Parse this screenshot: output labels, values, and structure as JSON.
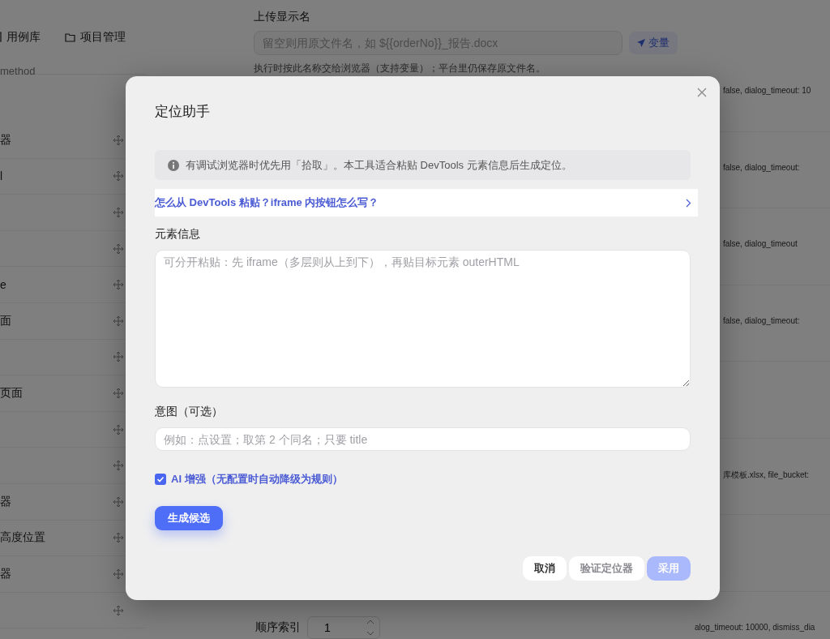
{
  "background": {
    "nav": [
      {
        "kind": "cases",
        "label": "用例库"
      },
      {
        "kind": "projects",
        "label": "项目管理"
      }
    ],
    "list_header": "method",
    "rows": [
      {
        "label": "器"
      },
      {
        "label": "l"
      },
      {},
      {},
      {
        "label": "e"
      },
      {
        "label": "面"
      },
      {},
      {
        "label": "页面"
      },
      {},
      {},
      {
        "label": "器"
      },
      {
        "label": "高度位置"
      },
      {
        "label": "器"
      },
      {}
    ],
    "right_rows": [
      {
        "label": "false, dialog_timeout: 10"
      },
      {
        "label": "false, dialog_timeout:"
      },
      {
        "label": "false, dialog_timeout"
      },
      {
        "label": "false, dialog_timeout:"
      },
      {},
      {
        "label": "库模板.xlsx, file_bucket:"
      },
      {},
      {
        "label": "alog_timeout: 10000, dismiss_dia"
      }
    ],
    "drawer": {
      "name_label": "上传显示名",
      "name_placeholder": "留空则用原文件名，如 ${{orderNo}}_报告.docx",
      "variable_button": "变量",
      "hint": "执行时按此名称交给浏览器（支持变量）；平台里仍保存原文件名。",
      "order_label": "顺序索引",
      "order_value": "1"
    }
  },
  "dialog": {
    "title": "定位助手",
    "info": "有调试浏览器时优先用「拾取」。本工具适合粘贴 DevTools 元素信息后生成定位。",
    "help_link": "怎么从 DevTools 粘贴？iframe 内按钮怎么写？",
    "element_label": "元素信息",
    "element_placeholder": "可分开粘贴：先 iframe（多层则从上到下），再贴目标元素 outerHTML",
    "intent_label": "意图（可选）",
    "intent_placeholder": "例如：点设置；取第 2 个同名；只要 title",
    "ai": {
      "label": "AI 增强（无配置时自动降级为规则）",
      "checked": true
    },
    "generate_button": "生成候选",
    "footer_buttons": [
      {
        "label": "取消",
        "kind": "plain",
        "disabled": false
      },
      {
        "label": "验证定位器",
        "kind": "plain",
        "disabled": true
      },
      {
        "label": "采用",
        "kind": "primary",
        "disabled": true
      }
    ]
  }
}
